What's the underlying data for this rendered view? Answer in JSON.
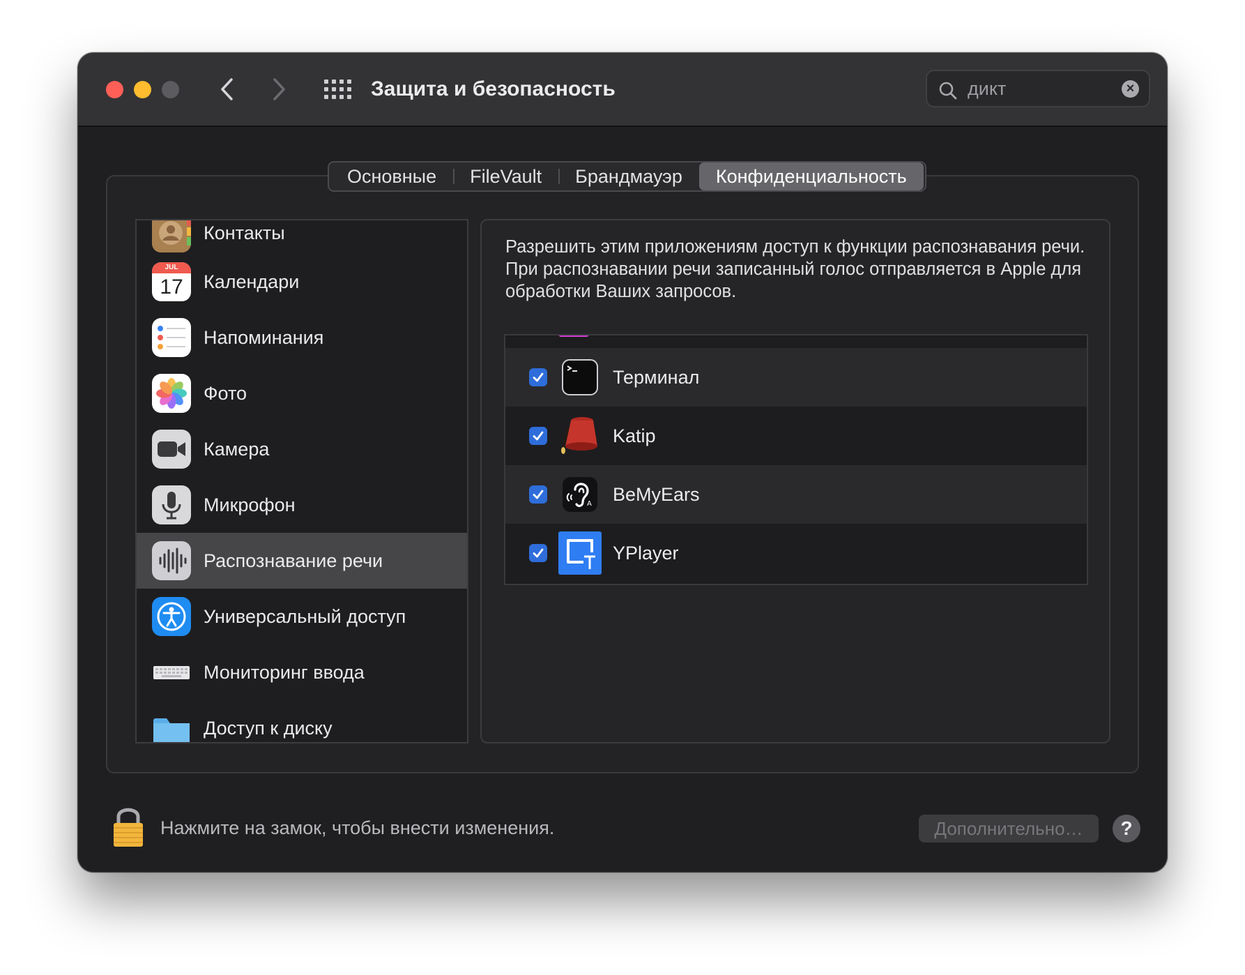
{
  "window": {
    "title": "Защита и безопасность",
    "controls": [
      "close",
      "minimize",
      "zoom"
    ],
    "nav_icons": [
      "chevron-left-icon",
      "chevron-right-icon",
      "grid-icon"
    ]
  },
  "search": {
    "value": "дикт",
    "icon": "search-icon",
    "clear_icon": "clear-icon"
  },
  "tabs": [
    {
      "label": "Основные",
      "selected": false
    },
    {
      "label": "FileVault",
      "selected": false
    },
    {
      "label": "Брандмауэр",
      "selected": false
    },
    {
      "label": "Конфиденциальность",
      "selected": true
    }
  ],
  "sidebar": {
    "items": [
      {
        "label": "Контакты",
        "icon": "contacts-icon",
        "selected": false
      },
      {
        "label": "Календари",
        "icon": "calendar-icon",
        "selected": false,
        "icon_text": {
          "month": "JUL",
          "day": "17"
        }
      },
      {
        "label": "Напоминания",
        "icon": "reminders-icon",
        "selected": false
      },
      {
        "label": "Фото",
        "icon": "photos-icon",
        "selected": false
      },
      {
        "label": "Камера",
        "icon": "camera-icon",
        "selected": false
      },
      {
        "label": "Микрофон",
        "icon": "microphone-icon",
        "selected": false
      },
      {
        "label": "Распознавание речи",
        "icon": "speech-recognition-icon",
        "selected": true
      },
      {
        "label": "Универсальный доступ",
        "icon": "accessibility-icon",
        "selected": false
      },
      {
        "label": "Мониторинг ввода",
        "icon": "keyboard-icon",
        "selected": false
      },
      {
        "label": "Доступ к диску",
        "icon": "folder-icon",
        "selected": false
      }
    ]
  },
  "panel": {
    "description": "Разрешить этим приложениям доступ к функции распознавания речи. При распознавании речи записанный голос отправляется в Apple для обработки Ваших запросов.",
    "apps": [
      {
        "name": "Терминал",
        "checked": true,
        "icon": "terminal-icon"
      },
      {
        "name": "Katip",
        "checked": true,
        "icon": "fez-icon"
      },
      {
        "name": "BeMyEars",
        "checked": true,
        "icon": "ear-icon"
      },
      {
        "name": "YPlayer",
        "checked": true,
        "icon": "yplayer-icon"
      }
    ]
  },
  "footer": {
    "lock_icon": "lock-icon",
    "lock_text": "Нажмите на замок, чтобы внести изменения.",
    "advanced_button": "Дополнительно…",
    "help_button": "?"
  },
  "colors": {
    "window_bg": "#1f1f21",
    "titlebar_bg": "#333336",
    "selection": "#464649",
    "checkbox": "#2e6dda",
    "close": "#ff5f57",
    "minimize": "#febc2e"
  }
}
